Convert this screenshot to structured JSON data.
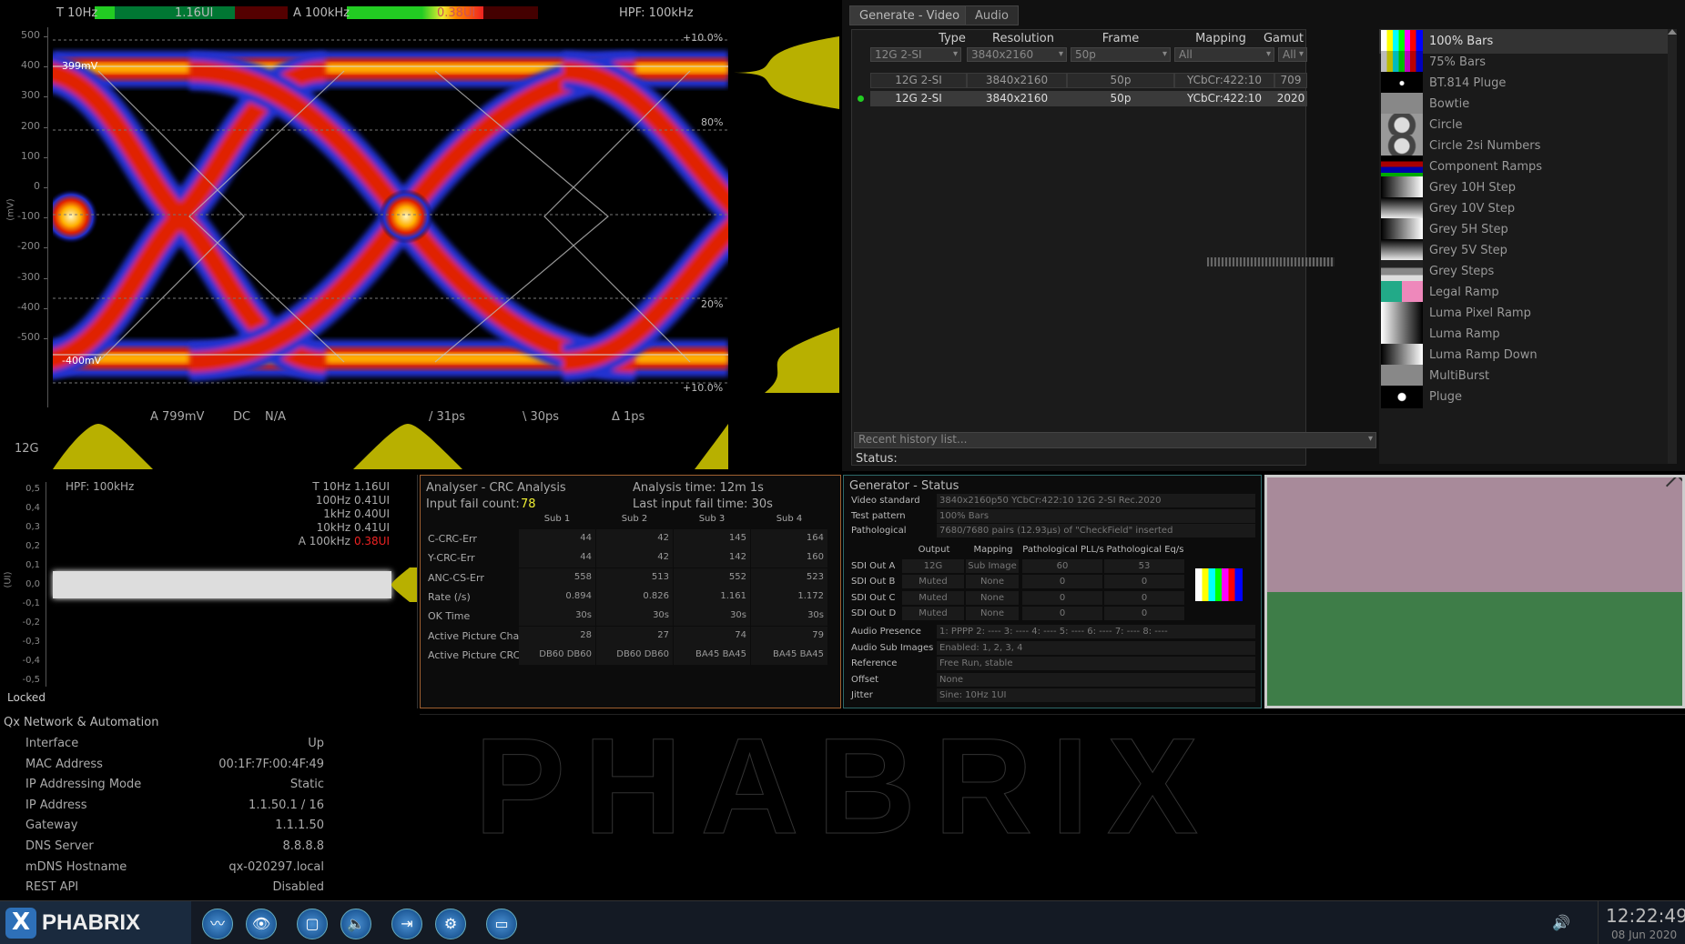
{
  "eye": {
    "t_label": "T 10Hz",
    "t_value": "1.16UI",
    "a_label": "A 100kHz",
    "a_value": "0.38UI",
    "hpf": "HPF: 100kHz",
    "top_marker": "399mV",
    "bottom_marker": "-400mV",
    "pct_top": "+10.0%",
    "pct_80": "80%",
    "pct_20": "20%",
    "pct_bottom": "+10.0%",
    "y_ticks": [
      "500",
      "400",
      "300",
      "200",
      "100",
      "0",
      "-100",
      "-200",
      "-300",
      "-400",
      "-500"
    ],
    "y_unit": "(mV)",
    "amp": "A 799mV",
    "dc": "DC",
    "na": "N/A",
    "rise": "/ 31ps",
    "fall": "\\ 30ps",
    "delta": "Δ 1ps",
    "rate": "12G"
  },
  "generator": {
    "tabs": [
      "Generate - Video",
      "Audio"
    ],
    "headers": [
      "Type",
      "Resolution",
      "Frame",
      "Mapping",
      "Gamut"
    ],
    "filters": [
      "12G 2-SI",
      "3840x2160",
      "50p",
      "All",
      "All"
    ],
    "rows": [
      [
        "12G 2-SI",
        "3840x2160",
        "50p",
        "YCbCr:422:10",
        "709"
      ],
      [
        "12G 2-SI",
        "3840x2160",
        "50p",
        "YCbCr:422:10",
        "2020"
      ]
    ],
    "history_placeholder": "Recent history list...",
    "status_label": "Status:"
  },
  "patterns": [
    {
      "name": "100% Bars",
      "thumb": "bars"
    },
    {
      "name": "75% Bars",
      "thumb": "bars75"
    },
    {
      "name": "BT.814 Pluge",
      "thumb": "pluge"
    },
    {
      "name": "Bowtie",
      "thumb": "grey"
    },
    {
      "name": "Circle",
      "thumb": "circle"
    },
    {
      "name": "Circle 2si Numbers",
      "thumb": "circle"
    },
    {
      "name": "Component Ramps",
      "thumb": "comp"
    },
    {
      "name": "Grey 10H Step",
      "thumb": "hstep"
    },
    {
      "name": "Grey 10V Step",
      "thumb": "vstep"
    },
    {
      "name": "Grey 5H Step",
      "thumb": "hstep"
    },
    {
      "name": "Grey 5V Step",
      "thumb": "vstep"
    },
    {
      "name": "Grey Steps",
      "thumb": "steps"
    },
    {
      "name": "Legal Ramp",
      "thumb": "legal"
    },
    {
      "name": "Luma Pixel Ramp",
      "thumb": "ramp"
    },
    {
      "name": "Luma Ramp",
      "thumb": "ramp"
    },
    {
      "name": "Luma Ramp Down",
      "thumb": "rampdown"
    },
    {
      "name": "MultiBurst",
      "thumb": "grey"
    },
    {
      "name": "Pluge",
      "thumb": "pluge2"
    }
  ],
  "jitter": {
    "hpf": "HPF: 100kHz",
    "lines": [
      {
        "text": "T 10Hz 1.16UI",
        "red": false
      },
      {
        "text": "100Hz 0.41UI",
        "red": false
      },
      {
        "text": "1kHz 0.40UI",
        "red": false
      },
      {
        "text": "10kHz 0.41UI",
        "red": false
      }
    ],
    "last_label": "A 100kHz",
    "last_value": "0.38UI",
    "y_ticks": [
      "0,5",
      "0,4",
      "0,3",
      "0,2",
      "0,1",
      "0,0",
      "-0,1",
      "-0,2",
      "-0,3",
      "-0,4",
      "-0,5"
    ],
    "y_unit": "(UI)",
    "locked": "Locked"
  },
  "crc": {
    "title": "Analyser - CRC Analysis",
    "analysis_time": "Analysis time: 12m 1s",
    "input_fail_label": "Input fail count:",
    "input_fail_value": "78",
    "last_fail": "Last input fail time: 30s",
    "subs": [
      "Sub 1",
      "Sub 2",
      "Sub 3",
      "Sub 4"
    ],
    "rows": [
      {
        "label": "C-CRC-Err",
        "values": [
          "44",
          "42",
          "145",
          "164"
        ],
        "red": true
      },
      {
        "label": "Y-CRC-Err",
        "values": [
          "44",
          "42",
          "142",
          "160"
        ],
        "red": true
      },
      {
        "label": "ANC-CS-Err",
        "values": [
          "558",
          "513",
          "552",
          "523"
        ],
        "red": true
      },
      {
        "label": "Rate (/s)",
        "values": [
          "0.894",
          "0.826",
          "1.161",
          "1.172"
        ],
        "red": false
      },
      {
        "label": "OK Time",
        "values": [
          "30s",
          "30s",
          "30s",
          "30s"
        ],
        "red": false
      },
      {
        "label": "Active Picture Changes",
        "values": [
          "28",
          "27",
          "74",
          "79"
        ],
        "red": false
      },
      {
        "label": "Active Picture CRC",
        "values": [
          "DB60 DB60",
          "DB60 DB60",
          "BA45 BA45",
          "BA45 BA45"
        ],
        "red": false
      }
    ]
  },
  "gstatus": {
    "title": "Generator - Status",
    "top": [
      {
        "k": "Video standard",
        "v": "3840x2160p50 YCbCr:422:10 12G 2-SI Rec.2020"
      },
      {
        "k": "Test pattern",
        "v": "100% Bars"
      },
      {
        "k": "Pathological",
        "v": "7680/7680 pairs (12.93µs) of \"CheckField\" inserted"
      }
    ],
    "out_headers": [
      "Output",
      "Mapping",
      "Pathological PLL/s",
      "Pathological Eq/s"
    ],
    "outputs": [
      {
        "name": "SDI Out A",
        "output": "12G",
        "mapping": "Sub Image ...",
        "pll": "60",
        "eq": "53"
      },
      {
        "name": "SDI Out B",
        "output": "Muted",
        "mapping": "None",
        "pll": "0",
        "eq": "0"
      },
      {
        "name": "SDI Out C",
        "output": "Muted",
        "mapping": "None",
        "pll": "0",
        "eq": "0"
      },
      {
        "name": "SDI Out D",
        "output": "Muted",
        "mapping": "None",
        "pll": "0",
        "eq": "0"
      }
    ],
    "bottom": [
      {
        "k": "Audio Presence",
        "v": "1: PPPP 2: ---- 3: ---- 4: ---- 5: ---- 6: ---- 7: ---- 8: ----"
      },
      {
        "k": "Audio Sub Images",
        "v": "Enabled: 1, 2, 3, 4"
      },
      {
        "k": "Reference",
        "v": "Free Run, stable"
      },
      {
        "k": "Offset",
        "v": "None"
      },
      {
        "k": "Jitter",
        "v": "Sine: 10Hz 1UI"
      }
    ]
  },
  "network": {
    "title": "Qx Network & Automation",
    "rows": [
      {
        "k": "Interface",
        "v": "Up"
      },
      {
        "k": "MAC Address",
        "v": "00:1F:7F:00:4F:49"
      },
      {
        "k": "IP Addressing Mode",
        "v": "Static"
      },
      {
        "k": "IP Address",
        "v": "1.1.50.1 / 16"
      },
      {
        "k": "Gateway",
        "v": "1.1.1.50"
      },
      {
        "k": "DNS Server",
        "v": "8.8.8.8"
      },
      {
        "k": "mDNS Hostname",
        "v": "qx-020297.local"
      },
      {
        "k": "REST API",
        "v": "Disabled"
      }
    ]
  },
  "watermark": "PHABRIX",
  "taskbar": {
    "brand": "PHABRIX",
    "icons": [
      "waveform-icon",
      "eye-icon",
      "window-icon",
      "speaker-alert-icon",
      "export-icon",
      "network-icon",
      "monitor-icon"
    ],
    "time": "12:22:49",
    "date": "08 Jun 2020"
  },
  "colors": {
    "accent": "#2e6a6a",
    "crc_border": "#a06030",
    "error_red": "#e22",
    "eye_yellow": "#b8b000"
  }
}
